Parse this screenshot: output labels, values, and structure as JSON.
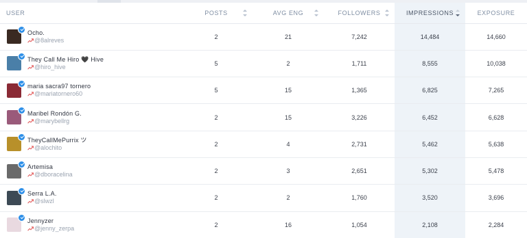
{
  "columns": {
    "user": "USER",
    "posts": "POSTS",
    "avg_eng": "AVG ENG",
    "followers": "FOLLOWERS",
    "impressions": "IMPRESSIONS",
    "exposure": "EXPOSURE"
  },
  "colors": {
    "twitter_badge": "#2d8fe8",
    "trend_icon": "#e25a5a",
    "highlight_column": "#eef3f8"
  },
  "rows": [
    {
      "name": "Ocho.",
      "handle": "@8alreves",
      "posts": "2",
      "avg_eng": "21",
      "followers": "7,242",
      "impressions": "14,484",
      "exposure": "14,660",
      "avatar_color": "#3a2a22"
    },
    {
      "name": "They Call Me Hiro 🖤 Hive",
      "handle": "@hiro_hive",
      "posts": "5",
      "avg_eng": "2",
      "followers": "1,711",
      "impressions": "8,555",
      "exposure": "10,038",
      "avatar_color": "#4a7fa8"
    },
    {
      "name": "maria sacra97 tornero",
      "handle": "@mariatornero60",
      "posts": "5",
      "avg_eng": "15",
      "followers": "1,365",
      "impressions": "6,825",
      "exposure": "7,265",
      "avatar_color": "#8a2a35"
    },
    {
      "name": "Maribel Rondón G.",
      "handle": "@marybellrg",
      "posts": "2",
      "avg_eng": "15",
      "followers": "3,226",
      "impressions": "6,452",
      "exposure": "6,628",
      "avatar_color": "#9a5a7a"
    },
    {
      "name": "TheyCallMePurrix ツ",
      "handle": "@alochito",
      "posts": "2",
      "avg_eng": "4",
      "followers": "2,731",
      "impressions": "5,462",
      "exposure": "5,638",
      "avatar_color": "#b8902a"
    },
    {
      "name": "Artemisa",
      "handle": "@dboracelina",
      "posts": "2",
      "avg_eng": "3",
      "followers": "2,651",
      "impressions": "5,302",
      "exposure": "5,478",
      "avatar_color": "#6a6a6a"
    },
    {
      "name": "Serra L.A.",
      "handle": "@slwzl",
      "posts": "2",
      "avg_eng": "2",
      "followers": "1,760",
      "impressions": "3,520",
      "exposure": "3,696",
      "avatar_color": "#3d4a55"
    },
    {
      "name": "Jennyzer",
      "handle": "@jenny_zerpa",
      "posts": "2",
      "avg_eng": "16",
      "followers": "1,054",
      "impressions": "2,108",
      "exposure": "2,284",
      "avatar_color": "#e9d9e0"
    }
  ]
}
